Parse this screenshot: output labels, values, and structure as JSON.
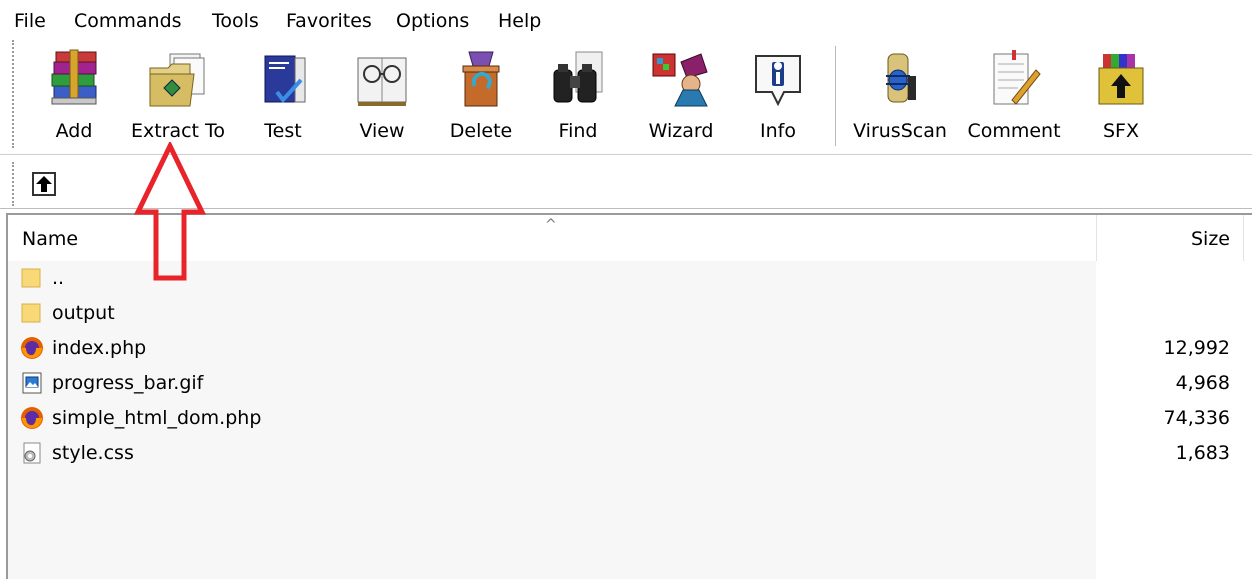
{
  "menu": {
    "items": [
      "File",
      "Commands",
      "Tools",
      "Favorites",
      "Options",
      "Help"
    ]
  },
  "toolbar": {
    "buttons": [
      {
        "label": "Add",
        "icon": "rar-books-icon"
      },
      {
        "label": "Extract To",
        "icon": "extract-folder-icon"
      },
      {
        "label": "Test",
        "icon": "test-book-check-icon"
      },
      {
        "label": "View",
        "icon": "view-glasses-book-icon"
      },
      {
        "label": "Delete",
        "icon": "delete-recycle-icon"
      },
      {
        "label": "Find",
        "icon": "find-binoculars-icon"
      },
      {
        "label": "Wizard",
        "icon": "wizard-icon"
      },
      {
        "label": "Info",
        "icon": "info-icon"
      },
      {
        "label": "VirusScan",
        "icon": "virusscan-bug-icon"
      },
      {
        "label": "Comment",
        "icon": "comment-notepad-icon"
      },
      {
        "label": "SFX",
        "icon": "sfx-archive-icon"
      }
    ]
  },
  "filelist": {
    "columns": {
      "name": "Name",
      "size": "Size"
    },
    "rows": [
      {
        "name": "..",
        "size": "",
        "type": "folder"
      },
      {
        "name": "output",
        "size": "",
        "type": "folder"
      },
      {
        "name": "index.php",
        "size": "12,992",
        "type": "firefox"
      },
      {
        "name": "progress_bar.gif",
        "size": "4,968",
        "type": "image"
      },
      {
        "name": "simple_html_dom.php",
        "size": "74,336",
        "type": "firefox"
      },
      {
        "name": "style.css",
        "size": "1,683",
        "type": "css"
      }
    ]
  },
  "colors": {
    "annotation_arrow": "#e8242a",
    "folder": "#f8d877",
    "selection_bg": "#f7f7f7"
  }
}
